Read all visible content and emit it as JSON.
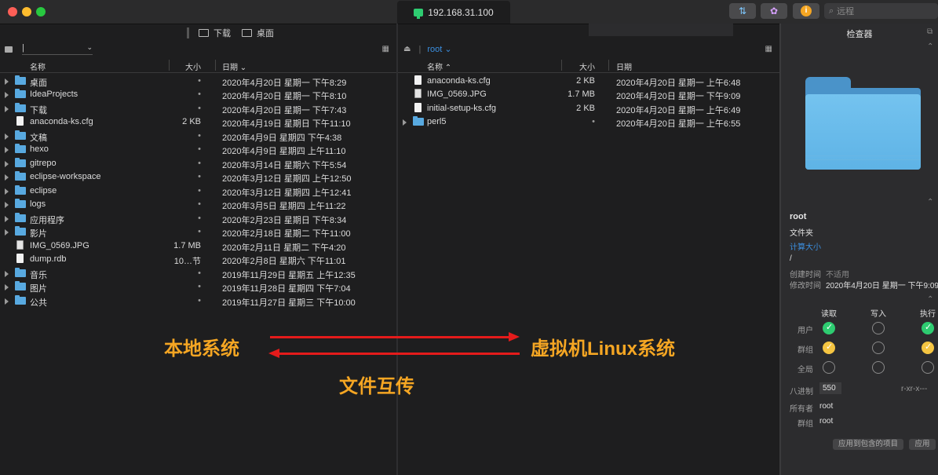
{
  "window": {
    "host_tab": "192.168.31.100",
    "search_placeholder": "远程"
  },
  "left_pane": {
    "path": [
      "下载",
      "桌面"
    ],
    "columns": {
      "name": "名称",
      "size": "大小",
      "date": "日期"
    },
    "rows": [
      {
        "type": "folder",
        "name": "桌面",
        "size": "•",
        "date": "2020年4月20日 星期一 下午8:29"
      },
      {
        "type": "folder",
        "name": "IdeaProjects",
        "size": "•",
        "date": "2020年4月20日 星期一 下午8:10"
      },
      {
        "type": "folder",
        "name": "下载",
        "size": "•",
        "date": "2020年4月20日 星期一 下午7:43"
      },
      {
        "type": "file",
        "name": "anaconda-ks.cfg",
        "size": "2 KB",
        "date": "2020年4月19日 星期日 下午11:10"
      },
      {
        "type": "folder",
        "name": "文稿",
        "size": "•",
        "date": "2020年4月9日 星期四 下午4:38"
      },
      {
        "type": "folder",
        "name": "hexo",
        "size": "•",
        "date": "2020年4月9日 星期四 上午11:10"
      },
      {
        "type": "folder",
        "name": "gitrepo",
        "size": "•",
        "date": "2020年3月14日 星期六 下午5:54"
      },
      {
        "type": "folder",
        "name": "eclipse-workspace",
        "size": "•",
        "date": "2020年3月12日 星期四 上午12:50"
      },
      {
        "type": "folder",
        "name": "eclipse",
        "size": "•",
        "date": "2020年3月12日 星期四 上午12:41"
      },
      {
        "type": "folder",
        "name": "logs",
        "size": "•",
        "date": "2020年3月5日 星期四 上午11:22"
      },
      {
        "type": "folder",
        "name": "应用程序",
        "size": "•",
        "date": "2020年2月23日 星期日 下午8:34"
      },
      {
        "type": "folder",
        "name": "影片",
        "size": "•",
        "date": "2020年2月18日 星期二 下午11:00"
      },
      {
        "type": "image",
        "name": "IMG_0569.JPG",
        "size": "1.7 MB",
        "date": "2020年2月11日 星期二 下午4:20"
      },
      {
        "type": "file",
        "name": "dump.rdb",
        "size": "10…节",
        "date": "2020年2月8日 星期六 下午11:01"
      },
      {
        "type": "folder",
        "name": "音乐",
        "size": "•",
        "date": "2019年11月29日 星期五 上午12:35"
      },
      {
        "type": "folder",
        "name": "图片",
        "size": "•",
        "date": "2019年11月28日 星期四 下午7:04"
      },
      {
        "type": "folder",
        "name": "公共",
        "size": "•",
        "date": "2019年11月27日 星期三 下午10:00"
      }
    ]
  },
  "right_pane": {
    "path": "root",
    "columns": {
      "name": "名称",
      "size": "大小",
      "date": "日期"
    },
    "rows": [
      {
        "type": "file",
        "name": "anaconda-ks.cfg",
        "size": "2 KB",
        "date": "2020年4月20日 星期一 上午6:48"
      },
      {
        "type": "image",
        "name": "IMG_0569.JPG",
        "size": "1.7 MB",
        "date": "2020年4月20日 星期一 下午9:09"
      },
      {
        "type": "file",
        "name": "initial-setup-ks.cfg",
        "size": "2 KB",
        "date": "2020年4月20日 星期一 上午6:49"
      },
      {
        "type": "folder",
        "name": "perl5",
        "size": "•",
        "date": "2020年4月20日 星期一 上午6:55"
      }
    ]
  },
  "inspector": {
    "title": "检查器",
    "name": "root",
    "kind": "文件夹",
    "calc_size": "计算大小",
    "path": "/",
    "created_label": "创建时间",
    "created_value": "不适用",
    "modified_label": "修改时间",
    "modified_value": "2020年4月20日 星期一 下午9:09",
    "perm_headers": [
      "读取",
      "写入",
      "执行"
    ],
    "perm_rows": [
      {
        "label": "用户",
        "read": "green",
        "write": "empty",
        "exec": "green"
      },
      {
        "label": "群组",
        "read": "yellow",
        "write": "empty",
        "exec": "yellow"
      },
      {
        "label": "全局",
        "read": "empty",
        "write": "empty",
        "exec": "empty"
      }
    ],
    "octal_label": "八进制",
    "octal_value": "550",
    "perm_string": "r-xr-x---",
    "owner_label": "所有者",
    "owner_value": "root",
    "group_label": "群组",
    "group_value": "root",
    "apply_recursive": "应用到包含的项目",
    "apply": "应用"
  },
  "annotations": {
    "local": "本地系统",
    "remote": "虚拟机Linux系统",
    "transfer": "文件互传"
  },
  "colors": {
    "accent_blue": "#58a9e0",
    "annotation_orange": "#f5a623",
    "arrow_red": "#e41b1b",
    "perm_green": "#2ecc71",
    "perm_yellow": "#f5c542"
  }
}
